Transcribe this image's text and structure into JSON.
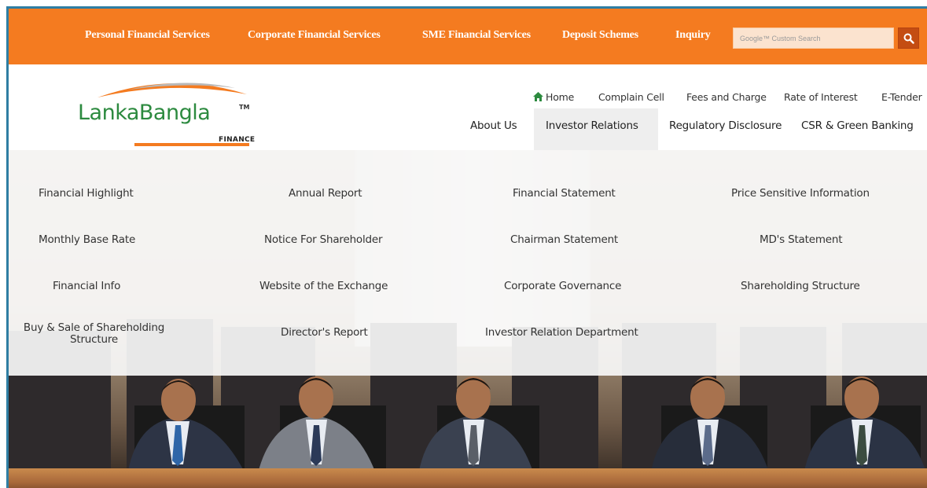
{
  "topbar": {
    "links": [
      "Personal Financial Services",
      "Corporate Financial Services",
      "SME Financial Services",
      "Deposit Schemes",
      "Inquiry"
    ],
    "search_placeholder": "Google™ Custom Search",
    "search_icon": "search-icon",
    "color": "#f47b20"
  },
  "logo": {
    "name": "LankaBangla",
    "tm": "TM",
    "sub": "FINANCE",
    "color": "#2c8a3f"
  },
  "utility_nav": [
    "Home",
    "Complain Cell",
    "Fees and Charge",
    "Rate of Interest",
    "E-Tender"
  ],
  "main_nav": [
    "About Us",
    "Investor Relations",
    "Regulatory Disclosure",
    "CSR & Green Banking"
  ],
  "dropdown": {
    "items": [
      "Financial Highlight",
      "Annual Report",
      "Financial Statement",
      "Price Sensitive Information",
      "Monthly Base Rate",
      "Notice For Shareholder",
      "Chairman Statement",
      "MD's Statement",
      "Financial Info",
      "Website of the Exchange",
      "Corporate Governance",
      "Shareholding Structure",
      "Buy & Sale of Shareholding Structure",
      "Director's Report",
      "Investor Relation Department"
    ]
  }
}
